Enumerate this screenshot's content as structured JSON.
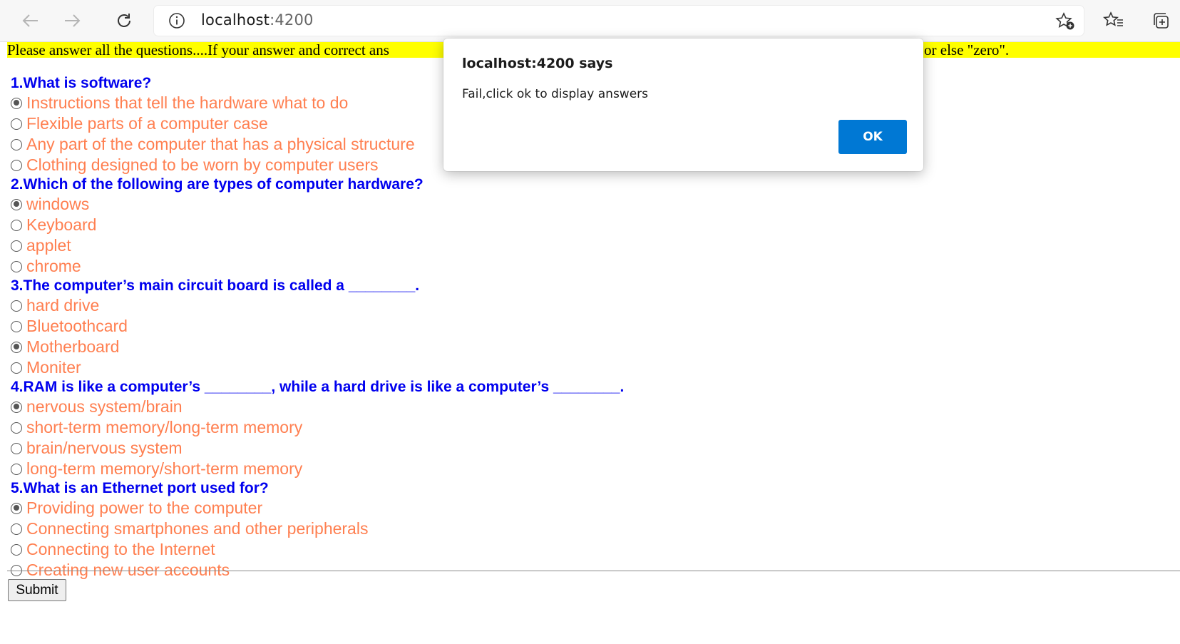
{
  "browser": {
    "url_host": "localhost",
    "url_port": ":4200",
    "icons": [
      "back-arrow-icon",
      "forward-arrow-icon",
      "refresh-icon",
      "info-icon",
      "add-favorite-icon",
      "favorites-icon",
      "collections-icon"
    ]
  },
  "banner": {
    "text_left": "Please answer all the questions....If your answer and correct ans",
    "text_right": "or else \"zero\"."
  },
  "questions": [
    {
      "text": "1.What is software?",
      "options": [
        {
          "label": "Instructions that tell the hardware what to do",
          "checked": true
        },
        {
          "label": "Flexible parts of a computer case",
          "checked": false
        },
        {
          "label": "Any part of the computer that has a physical structure",
          "checked": false
        },
        {
          "label": "Clothing designed to be worn by computer users",
          "checked": false
        }
      ]
    },
    {
      "text": "2.Which of the following are types of computer hardware?",
      "options": [
        {
          "label": "windows",
          "checked": true
        },
        {
          "label": "Keyboard",
          "checked": false
        },
        {
          "label": "applet",
          "checked": false
        },
        {
          "label": "chrome",
          "checked": false
        }
      ]
    },
    {
      "text": "3.The computer’s main circuit board is called a ________.",
      "options": [
        {
          "label": "hard drive",
          "checked": false
        },
        {
          "label": "Bluetoothcard",
          "checked": false
        },
        {
          "label": "Motherboard",
          "checked": true
        },
        {
          "label": "Moniter",
          "checked": false
        }
      ]
    },
    {
      "text": "4.RAM is like a computer’s ________, while a hard drive is like a computer’s ________.",
      "options": [
        {
          "label": "nervous system/brain",
          "checked": true
        },
        {
          "label": "short-term memory/long-term memory",
          "checked": false
        },
        {
          "label": "brain/nervous system",
          "checked": false
        },
        {
          "label": "long-term memory/short-term memory",
          "checked": false
        }
      ]
    },
    {
      "text": "5.What is an Ethernet port used for?",
      "options": [
        {
          "label": "Providing power to the computer",
          "checked": true
        },
        {
          "label": "Connecting smartphones and other peripherals",
          "checked": false
        },
        {
          "label": "Connecting to the Internet",
          "checked": false
        },
        {
          "label": "Creating new user accounts",
          "checked": false
        }
      ]
    }
  ],
  "submit_label": "Submit",
  "dialog": {
    "title": "localhost:4200 says",
    "message": "Fail,click ok to display answers",
    "ok_label": "OK",
    "accent": "#0078d4"
  },
  "colors": {
    "question": "#0000ee",
    "option": "#ff7f50",
    "banner_bg": "#ffff00"
  }
}
